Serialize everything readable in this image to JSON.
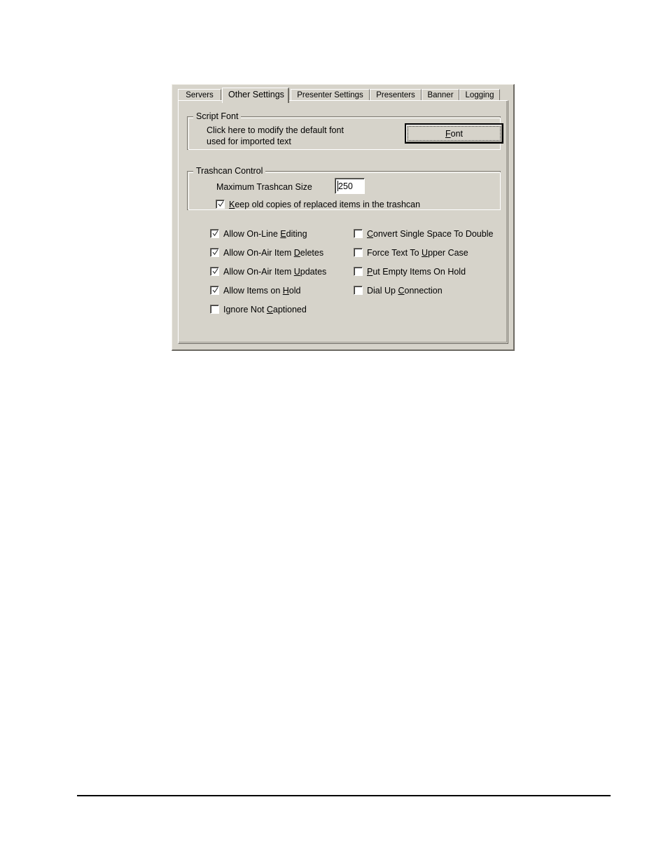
{
  "dialog": {
    "name": "Other Settings configuration dialog",
    "background_color": "#d6d3ca",
    "tabs": [
      {
        "id": "servers",
        "label": "Servers",
        "selected": false
      },
      {
        "id": "other-settings",
        "label": "Other Settings",
        "selected": true
      },
      {
        "id": "presenter-settings",
        "label": "Presenter Settings",
        "selected": false
      },
      {
        "id": "presenters",
        "label": "Presenters",
        "selected": false
      },
      {
        "id": "banner",
        "label": "Banner",
        "selected": false
      },
      {
        "id": "logging",
        "label": "Logging",
        "selected": false
      }
    ],
    "script_font_group": {
      "title": "Script Font",
      "description_line1": "Click here to modify the default font",
      "description_line2": "used for imported text",
      "font_button": {
        "label": "Font",
        "accelerator": "F",
        "is_default": true,
        "has_focus": true
      }
    },
    "trashcan_group": {
      "title": "Trashcan Control",
      "max_size_label": "Maximum Trashcan Size",
      "max_size_value": "250",
      "keep_old_copies": {
        "label_before": "",
        "accelerator": "K",
        "label_after": "eep old copies of replaced items in the trashcan",
        "full_label": "Keep old copies of replaced items in the trashcan",
        "checked": true
      }
    },
    "options_left": [
      {
        "id": "allow-on-line-editing",
        "before": "Allow On-Line ",
        "accelerator": "E",
        "after": "diting",
        "full_label": "Allow On-Line Editing",
        "checked": true
      },
      {
        "id": "allow-on-air-deletes",
        "before": "Allow On-Air Item ",
        "accelerator": "D",
        "after": "eletes",
        "full_label": "Allow On-Air Item Deletes",
        "checked": true
      },
      {
        "id": "allow-on-air-updates",
        "before": "Allow On-Air Item ",
        "accelerator": "U",
        "after": "pdates",
        "full_label": "Allow On-Air Item Updates",
        "checked": true
      },
      {
        "id": "allow-items-on-hold",
        "before": "Allow Items on ",
        "accelerator": "H",
        "after": "old",
        "full_label": "Allow Items on Hold",
        "checked": true
      },
      {
        "id": "ignore-not-captioned",
        "before": "Ignore Not ",
        "accelerator": "C",
        "after": "aptioned",
        "full_label": "Ignore Not Captioned",
        "checked": false
      }
    ],
    "options_right": [
      {
        "id": "convert-single-space",
        "before": "",
        "accelerator": "C",
        "after": "onvert Single Space To Double",
        "full_label": "Convert Single Space To Double",
        "checked": false
      },
      {
        "id": "force-text-upper-case",
        "before": "Force Text To ",
        "accelerator": "U",
        "after": "pper Case",
        "full_label": "Force Text To Upper Case",
        "checked": false
      },
      {
        "id": "put-empty-items-on-hold",
        "before": "",
        "accelerator": "P",
        "after": "ut Empty Items On Hold",
        "full_label": "Put Empty Items On Hold",
        "checked": false
      },
      {
        "id": "dial-up-connection",
        "before": "Dial Up ",
        "accelerator": "C",
        "after": "onnection",
        "full_label": "Dial Up Connection",
        "checked": false
      }
    ]
  }
}
